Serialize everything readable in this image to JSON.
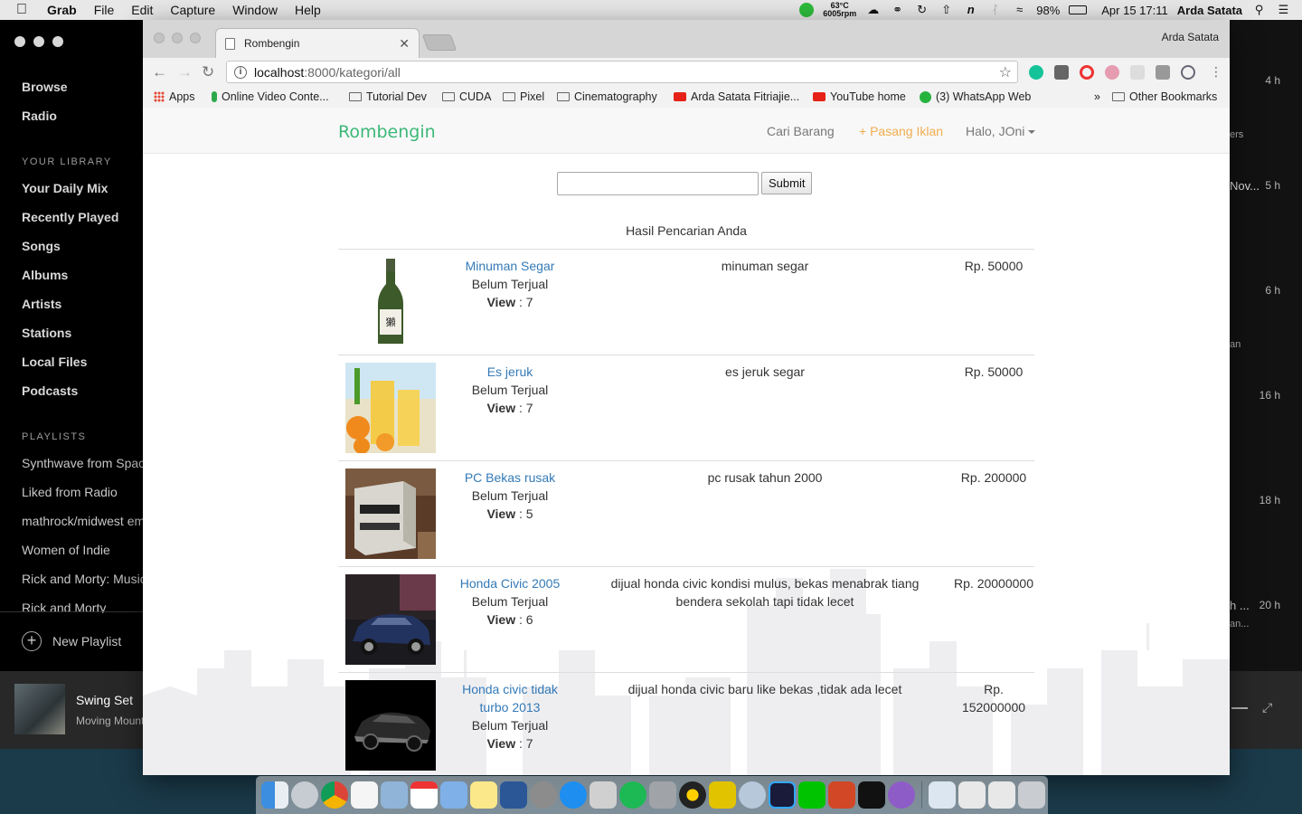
{
  "menubar": {
    "app_name": "Grab",
    "items": [
      "File",
      "Edit",
      "Capture",
      "Window",
      "Help"
    ],
    "cpu_temp": "63°C",
    "fan_speed": "6005rpm",
    "battery": "98%",
    "datetime": "Apr 15  17:11",
    "user": "Arda Satata"
  },
  "spotify": {
    "nav": [
      "Browse",
      "Radio"
    ],
    "library_heading": "YOUR LIBRARY",
    "library": [
      "Your Daily Mix",
      "Recently Played",
      "Songs",
      "Albums",
      "Artists",
      "Stations",
      "Local Files",
      "Podcasts"
    ],
    "playlists_heading": "PLAYLISTS",
    "playlists": [
      "Synthwave from Space",
      "Liked from Radio",
      "mathrock/midwest emo",
      "Women of Indie",
      "Rick and Morty: Music",
      "Rick and Morty"
    ],
    "new_playlist": "New Playlist",
    "now_playing_title": "Swing Set",
    "now_playing_artist": "Moving Mountains",
    "times": [
      "4 h",
      "5 h",
      "6 h",
      "16 h",
      "18 h",
      "20 h"
    ],
    "fragments": [
      "ers",
      "Nov...",
      "an",
      "h ...",
      "an..."
    ]
  },
  "browser": {
    "tab_title": "Rombengin",
    "profile": "Arda Satata",
    "url_host": "localhost",
    "url_rest": ":8000/kategori/all",
    "bookmarks": [
      "Apps",
      "Online Video Conte...",
      "Tutorial Dev",
      "CUDA",
      "Pixel",
      "Cinematography",
      "Arda Satata Fitriajie...",
      "YouTube home",
      "(3) WhatsApp Web"
    ],
    "overflow": "»",
    "other_bookmarks": "Other Bookmarks"
  },
  "site": {
    "brand": "Rombengin",
    "nav_search": "Cari Barang",
    "nav_post": "+ Pasang Iklan",
    "nav_user": "Halo, JOni",
    "search_placeholder": "",
    "submit": "Submit",
    "results_heading": "Hasil Pencarian Anda",
    "view_label": "View",
    "items": [
      {
        "title": "Minuman Segar",
        "status": "Belum Terjual",
        "views": "7",
        "desc": "minuman segar",
        "price": "Rp. 50000",
        "image": "sake-bottle-photo"
      },
      {
        "title": "Es jeruk",
        "status": "Belum Terjual",
        "views": "7",
        "desc": "es jeruk segar",
        "price": "Rp. 50000",
        "image": "orange-juice-photo"
      },
      {
        "title": "PC Bekas rusak",
        "status": "Belum Terjual",
        "views": "5",
        "desc": "pc rusak tahun 2000",
        "price": "Rp. 200000",
        "image": "broken-pc-photo"
      },
      {
        "title": "Honda Civic 2005",
        "status": "Belum Terjual",
        "views": "6",
        "desc": "dijual honda civic kondisi mulus, bekas menabrak tiang bendera sekolah tapi tidak lecet",
        "price": "Rp. 20000000",
        "image": "blue-civic-photo"
      },
      {
        "title": "Honda civic tidak turbo 2013",
        "status": "Belum Terjual",
        "views": "7",
        "desc": "dijual honda civic baru like bekas ,tidak ada lecet",
        "price": "Rp. 152000000",
        "image": "black-civic-photo"
      }
    ]
  },
  "colors": {
    "brand": "#3cb878",
    "link": "#337ab7",
    "accent_post": "#f0ad4e"
  }
}
